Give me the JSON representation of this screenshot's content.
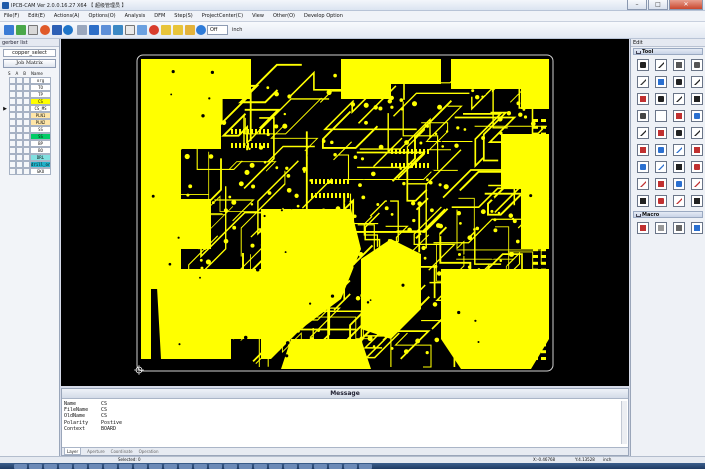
{
  "window": {
    "title": "IPCB-CAM Ver 2.0.0.16.27 X64  【 超级管理员 】",
    "controls": [
      "–",
      "□",
      "✕"
    ]
  },
  "menu": [
    "File(F)",
    "Edit(E)",
    "Actions(A)",
    "Options(O)",
    "Analysis",
    "DFM",
    "Step(S)",
    "ProjectCenter(C)",
    "View",
    "Other(O)",
    "Develop Option"
  ],
  "toolbar": {
    "combo_value": "Off",
    "unit": "inch"
  },
  "left_panel": {
    "title": "gerber list",
    "step_select": "copper_select",
    "job_matrix": "Job Matrix",
    "columns": [
      "S",
      "A",
      "B",
      "Name"
    ],
    "layers": [
      {
        "name": "org",
        "color": "#ffffff"
      },
      {
        "name": "TO",
        "color": "#ffffff"
      },
      {
        "name": "TP",
        "color": "#ffffff"
      },
      {
        "name": "CS",
        "color": "#ffff00"
      },
      {
        "name": "CS_MS",
        "color": "#ffffff"
      },
      {
        "name": "PLN1",
        "color": "#ffe6a8"
      },
      {
        "name": "PLN2",
        "color": "#ffe6a8"
      },
      {
        "name": "SS",
        "color": "#ffffff"
      },
      {
        "name": "SS",
        "color": "#00cc66"
      },
      {
        "name": "BP",
        "color": "#ffffff"
      },
      {
        "name": "BO",
        "color": "#ffffff"
      },
      {
        "name": "DRL",
        "color": "#80e0e0"
      },
      {
        "name": "drill_ort",
        "color": "#20b0c8"
      },
      {
        "name": "GKO",
        "color": "#ffffff"
      }
    ],
    "active_index": 4
  },
  "right_panel": {
    "header": "Edit",
    "tool_label": "Tool",
    "macro_label": "Macro"
  },
  "message": {
    "title": "Message",
    "rows": [
      {
        "key": "Name",
        "value": "CS"
      },
      {
        "key": "FileName",
        "value": "CS"
      },
      {
        "key": "OldName",
        "value": "CS"
      },
      {
        "key": "Polarity",
        "value": "Postive"
      },
      {
        "key": "Context",
        "value": "BOARD"
      }
    ],
    "tabs": [
      "Layer",
      "Aperture",
      "Coordinate",
      "Operation"
    ]
  },
  "status": {
    "selected": "Selected: 0",
    "x": "X:-0.46768",
    "y": "Y:4.13528",
    "unit": "inch"
  },
  "colors": {
    "copper": "#ffff00",
    "background": "#000000"
  }
}
